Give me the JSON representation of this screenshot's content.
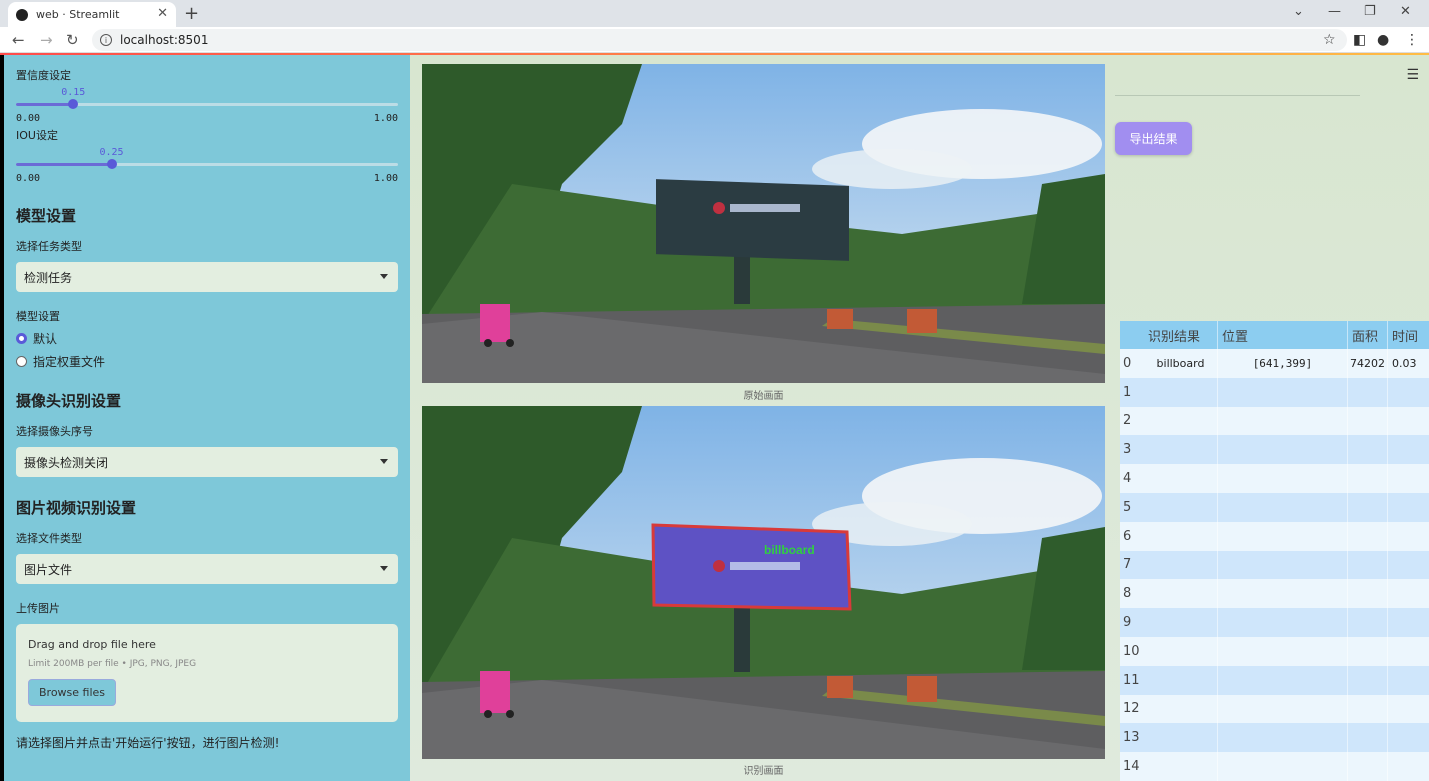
{
  "browser": {
    "tab_title": "web · Streamlit",
    "url": "localhost:8501"
  },
  "sidebar": {
    "conf_label": "置信度设定",
    "conf": {
      "value": "0.15",
      "min": "0.00",
      "max": "1.00",
      "fraction": 0.15
    },
    "iou_label": "IOU设定",
    "iou": {
      "value": "0.25",
      "min": "0.00",
      "max": "1.00",
      "fraction": 0.25
    },
    "model_header": "模型设置",
    "task_label": "选择任务类型",
    "task_value": "检测任务",
    "model_label": "模型设置",
    "radio_default": "默认",
    "radio_custom": "指定权重文件",
    "camera_header": "摄像头识别设置",
    "camera_label": "选择摄像头序号",
    "camera_value": "摄像头检测关闭",
    "file_header": "图片视频识别设置",
    "filetype_label": "选择文件类型",
    "filetype_value": "图片文件",
    "upload_label": "上传图片",
    "drag_text": "Drag and drop file here",
    "limit_text": "Limit 200MB per file • JPG, PNG, JPEG",
    "browse_label": "Browse files",
    "bottom_msg": "请选择图片并点击'开始运行'按钮，进行图片检测!"
  },
  "main": {
    "caption_original": "原始画面",
    "caption_detected": "识别画面",
    "detection_label": "billboard",
    "export_label": "导出结果"
  },
  "table": {
    "headers": [
      "识别结果",
      "位置",
      "面积",
      "时间"
    ],
    "rows": [
      {
        "idx": "0",
        "result": "billboard",
        "position": "[641,399]",
        "area": "74202",
        "time": "0.03"
      },
      {
        "idx": "1"
      },
      {
        "idx": "2"
      },
      {
        "idx": "3"
      },
      {
        "idx": "4"
      },
      {
        "idx": "5"
      },
      {
        "idx": "6"
      },
      {
        "idx": "7"
      },
      {
        "idx": "8"
      },
      {
        "idx": "9"
      },
      {
        "idx": "10"
      },
      {
        "idx": "11"
      },
      {
        "idx": "12"
      },
      {
        "idx": "13"
      },
      {
        "idx": "14"
      }
    ]
  },
  "colors": {
    "sidebar": "#7ec8d9",
    "accent": "#5a5ad8",
    "export": "#a18ef0",
    "bbox": "#e03030"
  }
}
